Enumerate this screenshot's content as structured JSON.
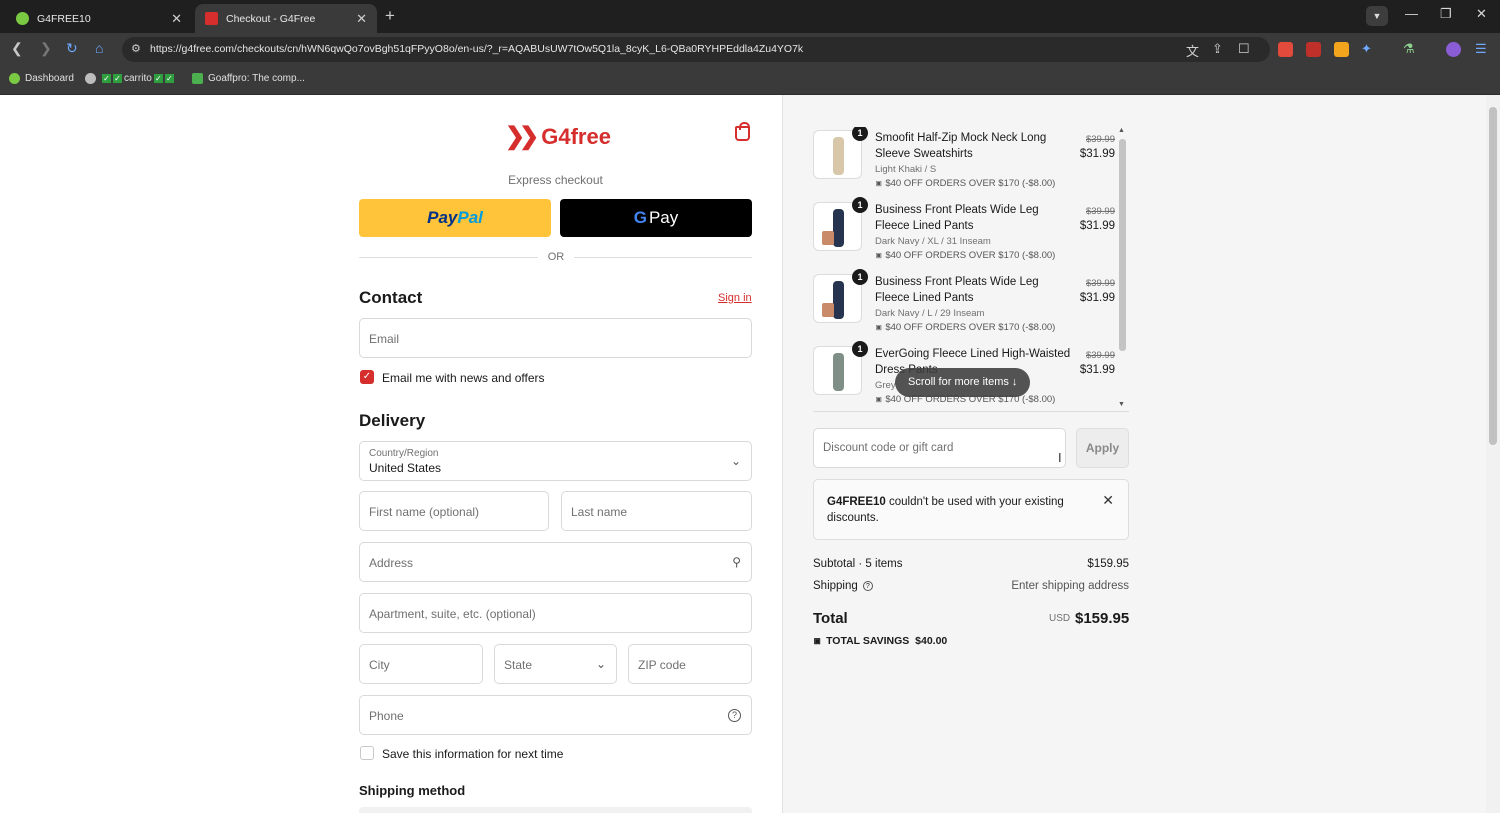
{
  "browser": {
    "tabs": [
      {
        "label": "G4FREE10"
      },
      {
        "label": "Checkout - G4Free"
      }
    ],
    "url": "https://g4free.com/checkouts/cn/hWN6qwQo7ovBgh51qFPyyO8o/en-us/?_r=AQABUsUW7tOw5Q1la_8cyK_L6-QBa0RYHPEddla4Zu4YO7k",
    "bookmarks": [
      {
        "label": "Dashboard"
      },
      {
        "label": "carrito"
      },
      {
        "label": "Goaffpro: The comp..."
      }
    ]
  },
  "store": {
    "name": "G4free"
  },
  "express": {
    "label": "Express checkout",
    "paypal": [
      "Pay",
      "Pal"
    ],
    "gpay": [
      "G",
      "Pay"
    ],
    "or": "OR"
  },
  "contact": {
    "heading": "Contact",
    "sign_in": "Sign in",
    "email_placeholder": "Email",
    "newsletter_label": "Email me with news and offers",
    "newsletter_checked": true
  },
  "delivery": {
    "heading": "Delivery",
    "country_label": "Country/Region",
    "country_value": "United States",
    "first_name_placeholder": "First name (optional)",
    "last_name_placeholder": "Last name",
    "address_placeholder": "Address",
    "apartment_placeholder": "Apartment, suite, etc. (optional)",
    "city_placeholder": "City",
    "state_placeholder": "State",
    "zip_placeholder": "ZIP code",
    "phone_placeholder": "Phone",
    "save_info_label": "Save this information for next time",
    "save_info_checked": false
  },
  "shipping_method": {
    "heading": "Shipping method"
  },
  "cart": {
    "items": [
      {
        "qty": "1",
        "name": "Smoofit Half-Zip Mock Neck Long Sleeve Sweatshirts",
        "variant": "Light Khaki / S",
        "discount": "$40 OFF ORDERS OVER $170 (-$8.00)",
        "original_price": "$39.99",
        "price": "$31.99",
        "color": "#d8c7a8"
      },
      {
        "qty": "1",
        "name": "Business Front Pleats Wide Leg Fleece Lined Pants",
        "variant": "Dark Navy / XL / 31 Inseam",
        "discount": "$40 OFF ORDERS OVER $170 (-$8.00)",
        "original_price": "$39.99",
        "price": "$31.99",
        "color": "#27344f"
      },
      {
        "qty": "1",
        "name": "Business Front Pleats Wide Leg Fleece Lined Pants",
        "variant": "Dark Navy / L / 29 Inseam",
        "discount": "$40 OFF ORDERS OVER $170 (-$8.00)",
        "original_price": "$39.99",
        "price": "$31.99",
        "color": "#27344f"
      },
      {
        "qty": "1",
        "name": "EverGoing Fleece Lined High-Waisted Dress Pants",
        "variant": "Grey",
        "discount": "$40 OFF ORDERS OVER $170 (-$8.00)",
        "original_price": "$39.99",
        "price": "$31.99",
        "color": "#7f8e86"
      }
    ],
    "scroll_hint": "Scroll for more items ↓",
    "discount_placeholder": "Discount code or gift card",
    "apply_label": "Apply",
    "notice_code": "G4FREE10",
    "notice_text": " couldn't be used with your existing discounts.",
    "subtotal_label": "Subtotal · 5 items",
    "subtotal_value": "$159.95",
    "shipping_label": "Shipping",
    "shipping_value": "Enter shipping address",
    "total_label": "Total",
    "total_currency": "USD",
    "total_value": "$159.95",
    "savings_label": "TOTAL SAVINGS",
    "savings_value": "$40.00"
  },
  "colors": {
    "brand": "#d62d2d",
    "paypal_yellow": "#ffc439",
    "chrome_dark": "#1f1f1f"
  }
}
